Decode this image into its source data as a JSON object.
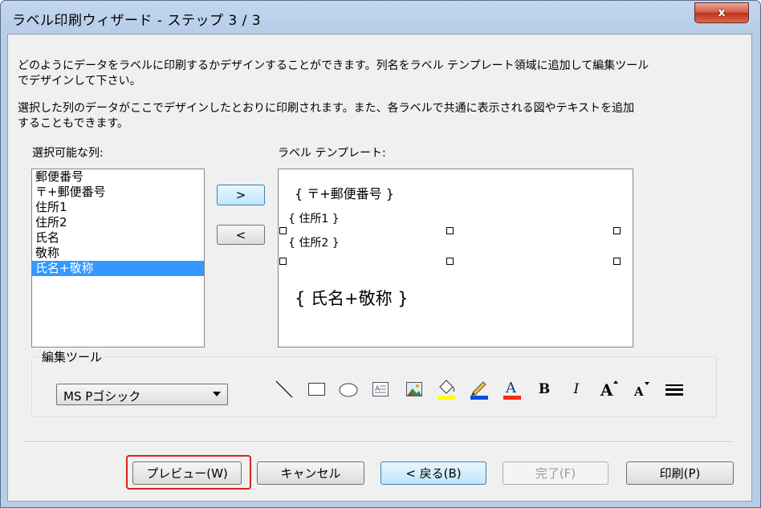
{
  "window": {
    "title": "ラベル印刷ウィザード - ステップ 3 / 3",
    "close_label": "x"
  },
  "description": {
    "line1": "どのようにデータをラベルに印刷するかデザインすることができます。列名をラベル テンプレート領域に追加して編集ツール",
    "line2": "でデザインして下さい。",
    "line3": "選択した列のデータがここでデザインしたとおりに印刷されます。また、各ラベルで共通に表示される図やテキストを追加",
    "line4": "することもできます。"
  },
  "columns": {
    "label": "選択可能な列:",
    "items": [
      "郵便番号",
      "〒+郵便番号",
      "住所1",
      "住所2",
      "氏名",
      "敬称",
      "氏名+敬称"
    ],
    "selected_index": 6
  },
  "move": {
    "add_label": ">",
    "remove_label": "<"
  },
  "template": {
    "label": "ラベル テンプレート:",
    "fields": [
      "{ 〒+郵便番号 }",
      "{ 住所1 }",
      "{ 住所2 }",
      "{ 氏名+敬称 }"
    ]
  },
  "tools": {
    "label": "編集ツール",
    "font_value": "MS Pゴシック",
    "bold_label": "B",
    "italic_label": "I",
    "grow_label": "A",
    "shrink_label": "A",
    "font_color_label": "A",
    "icons": [
      "line-icon",
      "rectangle-icon",
      "ellipse-icon",
      "text-box-icon",
      "image-icon",
      "fill-color-icon",
      "line-color-icon",
      "font-color-icon",
      "bold-icon",
      "italic-icon",
      "increase-font-icon",
      "decrease-font-icon",
      "line-weight-icon"
    ],
    "colors": {
      "fill": "#ffff00",
      "line": "#0050e0",
      "font": "#ff2a00"
    }
  },
  "footer": {
    "preview": "プレビュー(W)",
    "cancel": "キャンセル",
    "back": "< 戻る(B)",
    "finish": "完了(F)",
    "print": "印刷(P)"
  }
}
